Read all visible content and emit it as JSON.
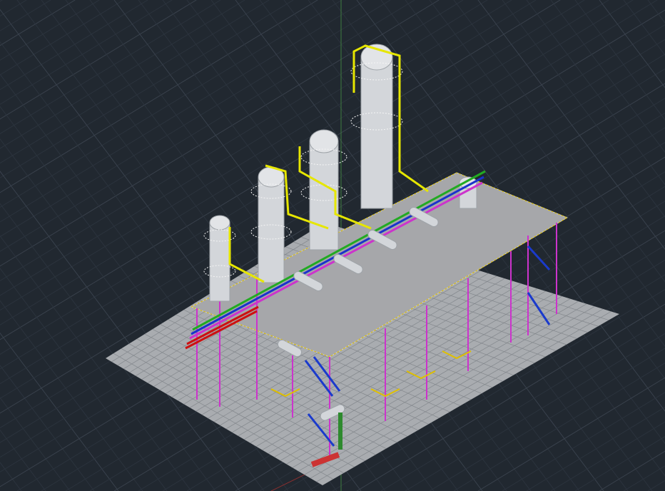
{
  "viewport": {
    "background": "#212830",
    "grid_minor_color": "#2b333d",
    "grid_major_color": "#39414c",
    "axis_y_color": "#3f7d3f",
    "axis_x_color": "#8a2f2f"
  },
  "model": {
    "ground_fill": "#a9acb0",
    "ground_grid": "#83878c",
    "deck_fill": "#a6a7aa",
    "vessel_fill": "#d3d6da",
    "vessel_shade": "#9ea3a8",
    "platform_color": "#f5f5f5",
    "structure_color": "#cc33cc",
    "pipe_yellow": "#e6e600",
    "pipe_green": "#22aa22",
    "pipe_blue": "#1a33cc",
    "pipe_red": "#cc1111",
    "stair_color": "#1a3acc",
    "handrail_color": "#e0c000"
  }
}
